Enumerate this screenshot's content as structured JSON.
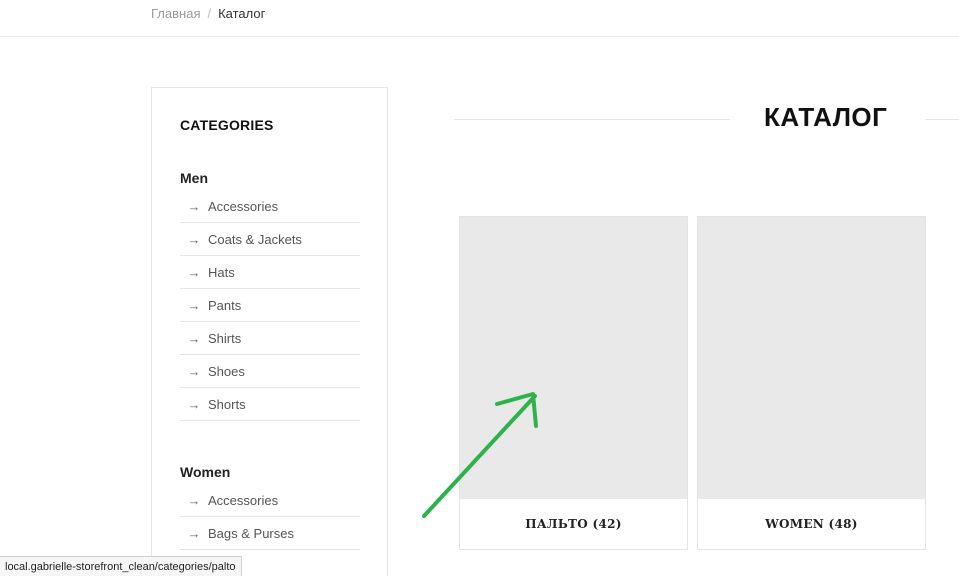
{
  "breadcrumb": {
    "home": "Главная",
    "separator": "/",
    "current": "Каталог"
  },
  "sidebar": {
    "title": "CATEGORIES",
    "groups": [
      {
        "title": "Men",
        "items": [
          "Accessories",
          "Coats & Jackets",
          "Hats",
          "Pants",
          "Shirts",
          "Shoes",
          "Shorts"
        ]
      },
      {
        "title": "Women",
        "items": [
          "Accessories",
          "Bags & Purses"
        ]
      }
    ],
    "arrow_glyph": "→"
  },
  "main": {
    "title": "КАТАЛОГ",
    "cards": [
      {
        "label": "ПАЛЬТО (42)"
      },
      {
        "label": "WOMEN (48)"
      }
    ]
  },
  "annotation": {
    "color": "#2db34a",
    "icon": "arrow-annotation-icon"
  },
  "status_bar": {
    "url": "local.gabrielle-storefront_clean/categories/palto"
  }
}
